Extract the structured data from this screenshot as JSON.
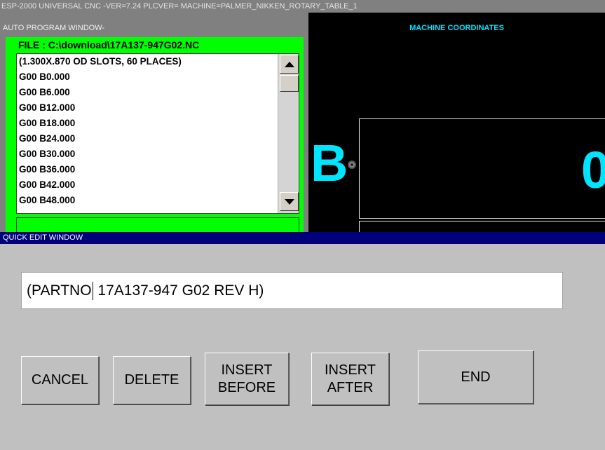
{
  "app": {
    "title": "ESP-2000 UNIVERSAL CNC -VER=7.24  PLCVER= MACHINE=PALMER_NIKKEN_ROTARY_TABLE_1"
  },
  "auto_program": {
    "window_title": "AUTO PROGRAM WINDOW-",
    "file_label": "FILE : C:\\download\\17A137-947G02.NC",
    "lines": [
      "(1.300X.870 OD SLOTS, 60 PLACES)",
      "G00 B0.000",
      "G00 B6.000",
      "G00 B12.000",
      "G00 B18.000",
      "G00 B24.000",
      "G00 B30.000",
      "G00 B36.000",
      "G00 B42.000",
      "G00 B48.000"
    ],
    "status_text": ""
  },
  "coordinates": {
    "title": "MACHINE COORDINATES",
    "axis": "B",
    "value": "0"
  },
  "quick_edit": {
    "window_title": "QUICK EDIT WINDOW",
    "field_before_caret": "(PARTNO",
    "field_after_caret": " 17A137-947 G02 REV H)",
    "buttons": {
      "cancel": "CANCEL",
      "delete": "DELETE",
      "insert_before_1": "INSERT",
      "insert_before_2": "BEFORE",
      "insert_after_1": "INSERT",
      "insert_after_2": "AFTER",
      "end": "END"
    }
  },
  "colors": {
    "green_frame": "#00ff00",
    "coord_cyan": "#00e5ff",
    "quick_edit_bar": "#00007b"
  }
}
